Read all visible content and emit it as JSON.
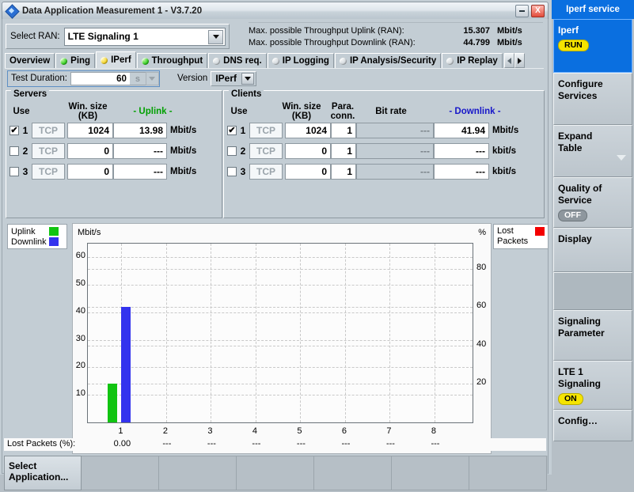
{
  "window": {
    "title": "Data Application Measurement 1 - V3.7.20",
    "icon": "app-diamond-icon",
    "minimize_label": "",
    "close_label": "X"
  },
  "ran": {
    "label": "Select RAN:",
    "value": "LTE Signaling 1",
    "options": [
      "LTE Signaling 1"
    ]
  },
  "throughput": {
    "uplink_label": "Max. possible Throughput Uplink (RAN):",
    "uplink_value": "15.307",
    "uplink_unit": "Mbit/s",
    "downlink_label": "Max. possible Throughput Downlink (RAN):",
    "downlink_value": "44.799",
    "downlink_unit": "Mbit/s"
  },
  "tabs": [
    {
      "label": "Overview",
      "led": "none",
      "active": false
    },
    {
      "label": "Ping",
      "led": "green",
      "active": false
    },
    {
      "label": "IPerf",
      "led": "yellow",
      "active": true
    },
    {
      "label": "Throughput",
      "led": "green",
      "active": false
    },
    {
      "label": "DNS req.",
      "led": "gray",
      "active": false
    },
    {
      "label": "IP Logging",
      "led": "gray",
      "active": false
    },
    {
      "label": "IP Analysis/Security",
      "led": "gray",
      "active": false
    },
    {
      "label": "IP Replay",
      "led": "gray",
      "active": false
    }
  ],
  "duration": {
    "label": "Test Duration:",
    "value": "60",
    "unit": "s",
    "version_label": "Version",
    "version_value": "IPerf"
  },
  "servers": {
    "title": "Servers",
    "headers": {
      "use": "Use",
      "winsize": "Win. size",
      "winsize_unit": "(KB)",
      "rate": "- Uplink -"
    },
    "rows": [
      {
        "checked": true,
        "index": "1",
        "proto": "TCP",
        "winsize": "1024",
        "rate": "13.98",
        "unit": "Mbit/s"
      },
      {
        "checked": false,
        "index": "2",
        "proto": "TCP",
        "winsize": "0",
        "rate": "---",
        "unit": "Mbit/s"
      },
      {
        "checked": false,
        "index": "3",
        "proto": "TCP",
        "winsize": "0",
        "rate": "---",
        "unit": "Mbit/s"
      }
    ]
  },
  "clients": {
    "title": "Clients",
    "headers": {
      "use": "Use",
      "winsize": "Win. size",
      "winsize_unit": "(KB)",
      "para": "Para.",
      "para2": "conn.",
      "bitrate": "Bit rate",
      "rate": "- Downlink -"
    },
    "rows": [
      {
        "checked": true,
        "index": "1",
        "proto": "TCP",
        "winsize": "1024",
        "para": "1",
        "bitrate": "---",
        "rate": "41.94",
        "unit": "Mbit/s"
      },
      {
        "checked": false,
        "index": "2",
        "proto": "TCP",
        "winsize": "0",
        "para": "1",
        "bitrate": "---",
        "rate": "---",
        "unit": "kbit/s"
      },
      {
        "checked": false,
        "index": "3",
        "proto": "TCP",
        "winsize": "0",
        "para": "1",
        "bitrate": "---",
        "rate": "---",
        "unit": "kbit/s"
      }
    ]
  },
  "legend_left": [
    {
      "label": "Uplink",
      "color": "#11c411"
    },
    {
      "label": "Downlink",
      "color": "#3333ee"
    }
  ],
  "legend_right": {
    "label_line1": "Lost",
    "label_line2": "Packets",
    "color": "#f40000"
  },
  "chart_data": {
    "type": "bar",
    "title": "",
    "ylabel": "Mbit/s",
    "ylabel_right": "%",
    "xlabel": "",
    "categories": [
      "1",
      "2",
      "3",
      "4",
      "5",
      "6",
      "7",
      "8"
    ],
    "ylim": [
      0,
      65
    ],
    "yticks": [
      10,
      20,
      30,
      40,
      50,
      60
    ],
    "ylim_right": [
      0,
      93
    ],
    "yticks_right": [
      20,
      40,
      60,
      80
    ],
    "grid": true,
    "legend_position": "outside-left-and-right",
    "series": [
      {
        "name": "Uplink",
        "color": "#11c411",
        "values": [
          13.98,
          null,
          null,
          null,
          null,
          null,
          null,
          null
        ]
      },
      {
        "name": "Downlink",
        "color": "#3333ee",
        "values": [
          41.94,
          null,
          null,
          null,
          null,
          null,
          null,
          null
        ]
      },
      {
        "name": "Lost Packets",
        "color": "#f40000",
        "values": [
          0.0,
          null,
          null,
          null,
          null,
          null,
          null,
          null
        ]
      }
    ]
  },
  "lost_packets": {
    "label": "Lost Packets (%):",
    "values": [
      "0.00",
      "---",
      "---",
      "---",
      "---",
      "---",
      "---",
      "---"
    ]
  },
  "bottom_bar": {
    "slots": [
      "Select Application...",
      "",
      "",
      "",
      "",
      "",
      ""
    ]
  },
  "sidebar": {
    "header": "Iperf service",
    "items": [
      {
        "label": "Iperf",
        "pill": "RUN",
        "pill_state": "run",
        "active": true,
        "caret": false
      },
      {
        "label": "Configure\nServices",
        "pill": "",
        "pill_state": "",
        "active": false,
        "caret": false
      },
      {
        "label": "Expand\nTable",
        "pill": "",
        "pill_state": "",
        "active": false,
        "caret": true
      },
      {
        "label": "Quality of\n Service",
        "pill": "OFF",
        "pill_state": "off",
        "active": false,
        "caret": false
      },
      {
        "label": "Display",
        "pill": "",
        "pill_state": "",
        "active": false,
        "caret": false
      },
      {
        "label": "",
        "pill": "",
        "pill_state": "",
        "active": false,
        "caret": false
      },
      {
        "label": "Signaling\nParameter",
        "pill": "",
        "pill_state": "",
        "active": false,
        "caret": false
      },
      {
        "label": "LTE 1\nSignaling",
        "pill": "ON",
        "pill_state": "on",
        "active": false,
        "caret": false
      },
      {
        "label": "Config…",
        "pill": "",
        "pill_state": "",
        "active": false,
        "caret": false
      }
    ]
  }
}
